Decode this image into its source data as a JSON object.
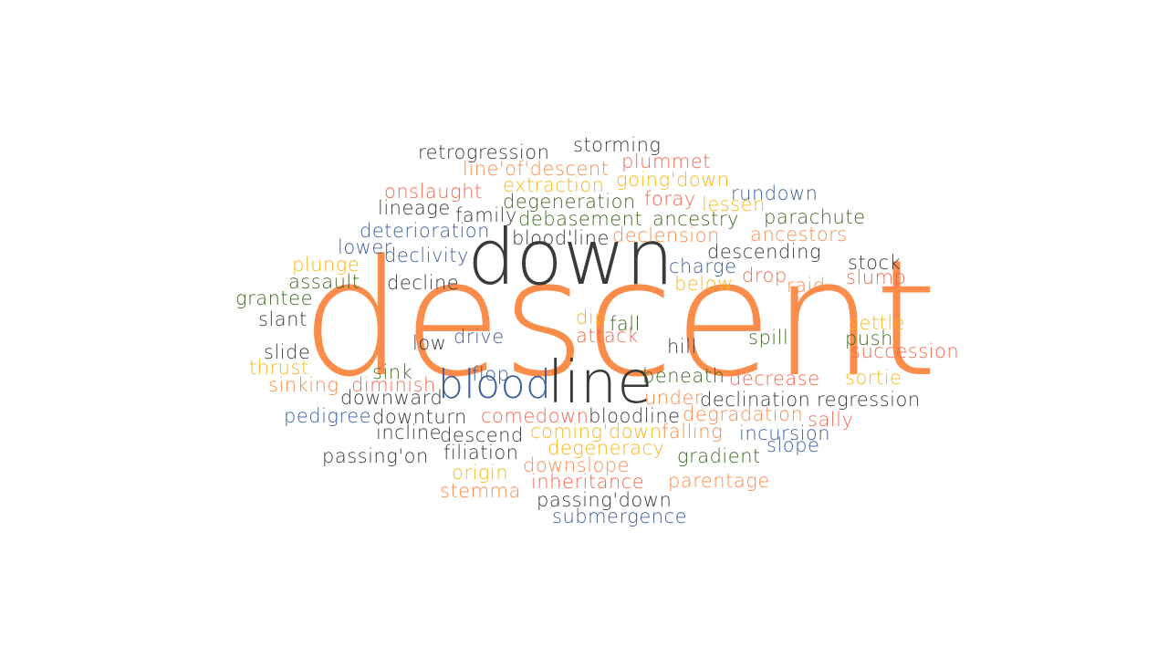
{
  "title_word": "descent",
  "colors": {
    "dark": "#3a3a3a",
    "orange": "#fb8c4a",
    "red": "#f4674e",
    "yellow": "#f9b71a",
    "green": "#3f6a25",
    "blue": "#3c5f9b"
  },
  "words": [
    {
      "text": "descent",
      "color": "orange"
    },
    {
      "text": "down",
      "color": "dark"
    },
    {
      "text": "line",
      "color": "dark"
    },
    {
      "text": "blood",
      "color": "blue"
    },
    {
      "text": "retrogression",
      "color": "dark"
    },
    {
      "text": "storming",
      "color": "dark"
    },
    {
      "text": "line'of'descent",
      "color": "orange"
    },
    {
      "text": "plummet",
      "color": "red"
    },
    {
      "text": "extraction",
      "color": "yellow"
    },
    {
      "text": "going'down",
      "color": "yellow"
    },
    {
      "text": "onslaught",
      "color": "red"
    },
    {
      "text": "degeneration",
      "color": "green"
    },
    {
      "text": "foray",
      "color": "red"
    },
    {
      "text": "rundown",
      "color": "blue"
    },
    {
      "text": "lessen",
      "color": "yellow"
    },
    {
      "text": "lineage",
      "color": "dark"
    },
    {
      "text": "family",
      "color": "dark"
    },
    {
      "text": "debasement",
      "color": "green"
    },
    {
      "text": "ancestry",
      "color": "green"
    },
    {
      "text": "parachute",
      "color": "green"
    },
    {
      "text": "deterioration",
      "color": "blue"
    },
    {
      "text": "blood'line",
      "color": "dark"
    },
    {
      "text": "declension",
      "color": "orange"
    },
    {
      "text": "ancestors",
      "color": "orange"
    },
    {
      "text": "lower",
      "color": "blue"
    },
    {
      "text": "declivity",
      "color": "blue"
    },
    {
      "text": "descending",
      "color": "dark"
    },
    {
      "text": "plunge",
      "color": "yellow"
    },
    {
      "text": "charge",
      "color": "blue"
    },
    {
      "text": "stock",
      "color": "dark"
    },
    {
      "text": "assault",
      "color": "green"
    },
    {
      "text": "decline",
      "color": "dark"
    },
    {
      "text": "drop",
      "color": "red"
    },
    {
      "text": "slump",
      "color": "red"
    },
    {
      "text": "below",
      "color": "yellow"
    },
    {
      "text": "raid",
      "color": "orange"
    },
    {
      "text": "grantee",
      "color": "green"
    },
    {
      "text": "slant",
      "color": "dark"
    },
    {
      "text": "dip",
      "color": "yellow"
    },
    {
      "text": "fall",
      "color": "green"
    },
    {
      "text": "settle",
      "color": "yellow"
    },
    {
      "text": "attack",
      "color": "red"
    },
    {
      "text": "spill",
      "color": "green"
    },
    {
      "text": "push",
      "color": "green"
    },
    {
      "text": "low",
      "color": "dark"
    },
    {
      "text": "drive",
      "color": "blue"
    },
    {
      "text": "hill",
      "color": "dark"
    },
    {
      "text": "succession",
      "color": "red"
    },
    {
      "text": "slide",
      "color": "dark"
    },
    {
      "text": "thrust",
      "color": "yellow"
    },
    {
      "text": "sink",
      "color": "green"
    },
    {
      "text": "flop",
      "color": "blue"
    },
    {
      "text": "beneath",
      "color": "green"
    },
    {
      "text": "decrease",
      "color": "red"
    },
    {
      "text": "sortie",
      "color": "yellow"
    },
    {
      "text": "sinking",
      "color": "orange"
    },
    {
      "text": "diminish",
      "color": "red"
    },
    {
      "text": "downward",
      "color": "dark"
    },
    {
      "text": "under",
      "color": "orange"
    },
    {
      "text": "declination",
      "color": "dark"
    },
    {
      "text": "regression",
      "color": "dark"
    },
    {
      "text": "pedigree",
      "color": "blue"
    },
    {
      "text": "downturn",
      "color": "dark"
    },
    {
      "text": "comedown",
      "color": "red"
    },
    {
      "text": "bloodline",
      "color": "dark"
    },
    {
      "text": "degradation",
      "color": "orange"
    },
    {
      "text": "sally",
      "color": "red"
    },
    {
      "text": "incline",
      "color": "dark"
    },
    {
      "text": "descend",
      "color": "dark"
    },
    {
      "text": "coming'down",
      "color": "yellow"
    },
    {
      "text": "falling",
      "color": "orange"
    },
    {
      "text": "incursion",
      "color": "blue"
    },
    {
      "text": "slope",
      "color": "blue"
    },
    {
      "text": "passing'on",
      "color": "dark"
    },
    {
      "text": "filiation",
      "color": "dark"
    },
    {
      "text": "degeneracy",
      "color": "yellow"
    },
    {
      "text": "gradient",
      "color": "green"
    },
    {
      "text": "origin",
      "color": "yellow"
    },
    {
      "text": "downslope",
      "color": "orange"
    },
    {
      "text": "inheritance",
      "color": "red"
    },
    {
      "text": "parentage",
      "color": "orange"
    },
    {
      "text": "stemma",
      "color": "orange"
    },
    {
      "text": "passing'down",
      "color": "dark"
    },
    {
      "text": "submergence",
      "color": "blue"
    }
  ]
}
